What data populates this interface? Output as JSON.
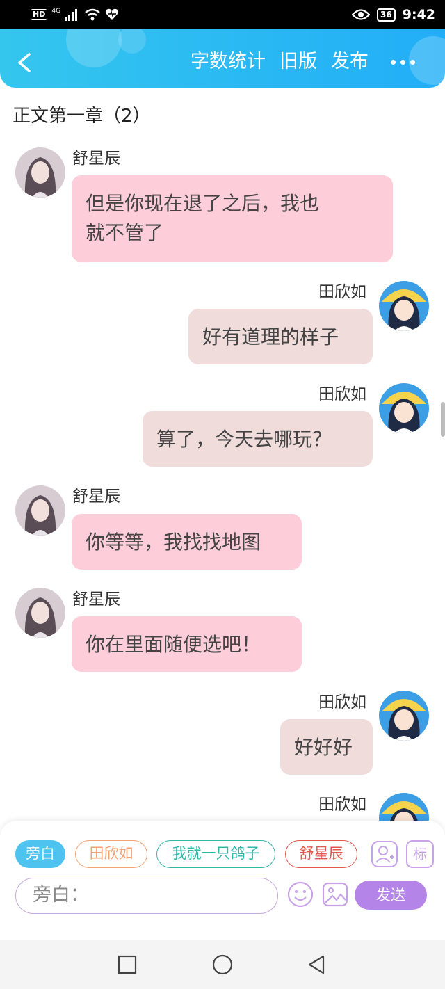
{
  "status_bar": {
    "hd_label": "HD",
    "network_label": "4G",
    "battery": "36",
    "time": "9:42"
  },
  "header": {
    "actions": [
      "字数统计",
      "旧版",
      "发布"
    ]
  },
  "chapter_title": "正文第一章（2）",
  "messages": [
    {
      "side": "left",
      "name": "舒星辰",
      "lines": [
        "但是你现在退了之后，我也",
        "就不管了"
      ]
    },
    {
      "side": "right",
      "name": "田欣如",
      "lines": [
        "好有道理的样子"
      ]
    },
    {
      "side": "right",
      "name": "田欣如",
      "lines": [
        "算了，今天去哪玩？"
      ]
    },
    {
      "side": "left",
      "name": "舒星辰",
      "lines": [
        "你等等，我找找地图"
      ]
    },
    {
      "side": "left",
      "name": "舒星辰",
      "lines": [
        "你在里面随便选吧！"
      ]
    },
    {
      "side": "right",
      "name": "田欣如",
      "lines": [
        "好好好"
      ]
    },
    {
      "side": "right",
      "name": "田欣如",
      "lines": []
    }
  ],
  "composer": {
    "roles": [
      {
        "label": "旁白",
        "color": "#4ec3f0",
        "selected": true
      },
      {
        "label": "田欣如",
        "color": "#f2a274",
        "selected": false
      },
      {
        "label": "我就一只鸽子",
        "color": "#2fb8a8",
        "selected": false
      },
      {
        "label": "舒星辰",
        "color": "#e0574d",
        "selected": false
      }
    ],
    "mark_label": "标",
    "input_placeholder": "旁白：",
    "send_label": "发送"
  },
  "colors": {
    "header_accent": "#22aef7",
    "left_bubble": "#fdcdd9",
    "right_bubble": "#f1dcdc",
    "send_button": "#b584e8"
  }
}
